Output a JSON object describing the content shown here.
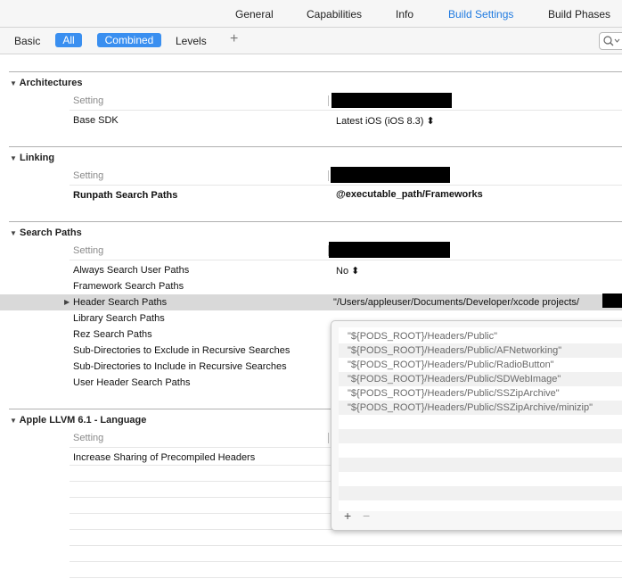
{
  "tabs": [
    {
      "label": "General",
      "active": false
    },
    {
      "label": "Capabilities",
      "active": false
    },
    {
      "label": "Info",
      "active": false
    },
    {
      "label": "Build Settings",
      "active": true
    },
    {
      "label": "Build Phases",
      "active": false
    }
  ],
  "filter": {
    "basic": "Basic",
    "all": "All",
    "combined": "Combined",
    "levels": "Levels",
    "add": "+",
    "search_icon": "magnifier-icon"
  },
  "sections": {
    "architectures": {
      "title": "Architectures",
      "setting_header": "Setting",
      "rows": [
        {
          "label": "Base SDK",
          "value": "Latest iOS (iOS 8.3) ⬍"
        }
      ]
    },
    "linking": {
      "title": "Linking",
      "setting_header": "Setting",
      "rows": [
        {
          "label": "Runpath Search Paths",
          "value": "@executable_path/Frameworks"
        }
      ]
    },
    "search_paths": {
      "title": "Search Paths",
      "setting_header": "Setting",
      "rows": [
        {
          "label": "Always Search User Paths",
          "value": "No ⬍"
        },
        {
          "label": "Framework Search Paths",
          "value": ""
        },
        {
          "label": "Header Search Paths",
          "value": "\"/Users/appleuser/Documents/Developer/xcode projects/"
        },
        {
          "label": "Library Search Paths",
          "value": ""
        },
        {
          "label": "Rez Search Paths",
          "value": ""
        },
        {
          "label": "Sub-Directories to Exclude in Recursive Searches",
          "value": ""
        },
        {
          "label": "Sub-Directories to Include in Recursive Searches",
          "value": ""
        },
        {
          "label": "User Header Search Paths",
          "value": ""
        }
      ]
    },
    "llvm": {
      "title": "Apple LLVM 6.1 - Language",
      "setting_header": "Setting",
      "rows": [
        {
          "label": "Increase Sharing of Precompiled Headers",
          "value": ""
        }
      ]
    }
  },
  "popover": {
    "paths": [
      "\"${PODS_ROOT}/Headers/Public\"",
      "\"${PODS_ROOT}/Headers/Public/AFNetworking\"",
      "\"${PODS_ROOT}/Headers/Public/RadioButton\"",
      "\"${PODS_ROOT}/Headers/Public/SDWebImage\"",
      "\"${PODS_ROOT}/Headers/Public/SSZipArchive\"",
      "\"${PODS_ROOT}/Headers/Public/SSZipArchive/minizip\""
    ],
    "add": "+",
    "remove": "−"
  },
  "disclosure": {
    "expanded": "▼",
    "collapsed": "▶"
  }
}
